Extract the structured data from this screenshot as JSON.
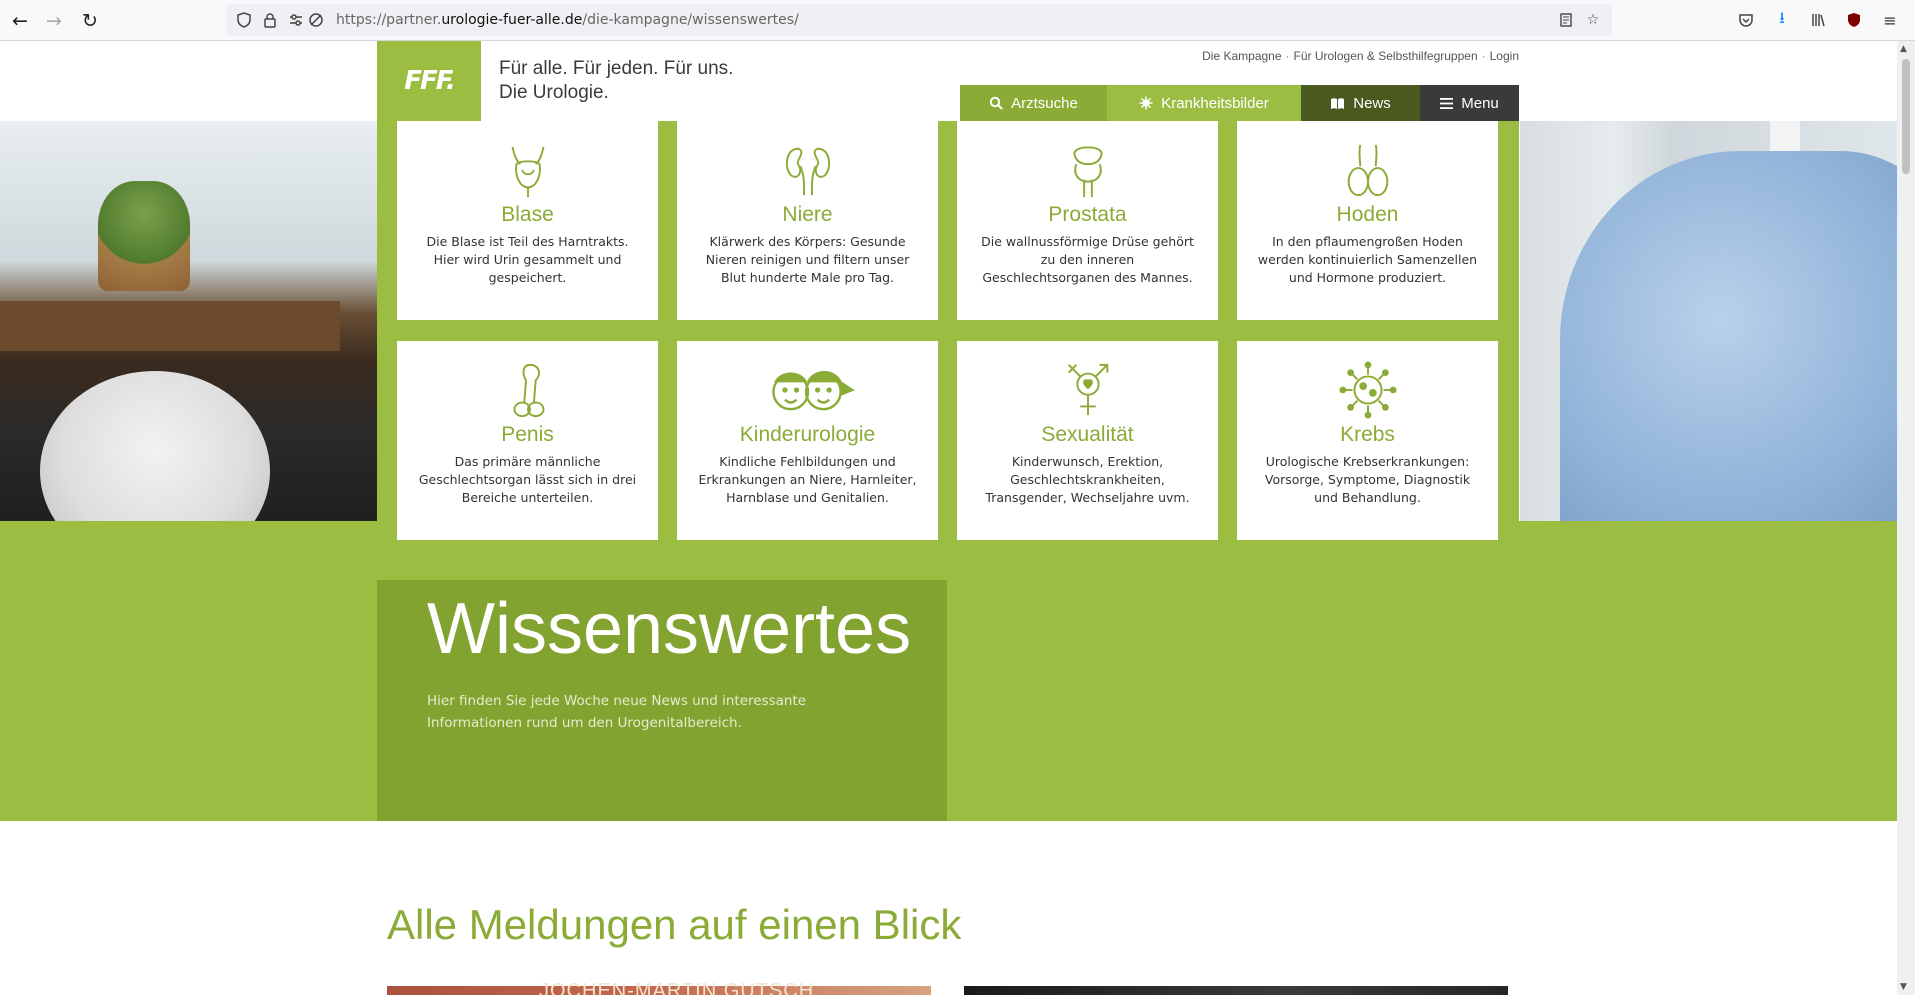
{
  "browser": {
    "url_prefix": "https://partner.",
    "url_domain": "urologie-fuer-alle.de",
    "url_path": "/die-kampagne/wissenswertes/"
  },
  "header": {
    "logo": "FFF.",
    "tagline_line1": "Für alle. Für jeden. Für uns.",
    "tagline_line2": "Die Urologie.",
    "toplinks": [
      "Die Kampagne",
      "Für Urologen & Selbsthilfegruppen",
      "Login"
    ],
    "toplink_separator": "·"
  },
  "nav": {
    "arztsuche": "Arztsuche",
    "krankheitsbilder": "Krankheitsbilder",
    "news": "News",
    "menu": "Menu"
  },
  "cards": [
    {
      "title": "Blase",
      "desc": "Die Blase ist Teil des Harntrakts. Hier wird Urin gesammelt und gespeichert."
    },
    {
      "title": "Niere",
      "desc": "Klärwerk des Körpers: Gesunde Nieren reinigen und filtern unser Blut hunderte Male pro Tag."
    },
    {
      "title": "Prostata",
      "desc": "Die wallnussförmige Drüse gehört zu den inneren Geschlechtsorganen des Mannes."
    },
    {
      "title": "Hoden",
      "desc": "In den pflaumengroßen Hoden werden kontinuierlich Samenzellen und Hormone produziert."
    },
    {
      "title": "Penis",
      "desc": "Das primäre männliche Geschlechtsorgan lässt sich in drei Bereiche unterteilen."
    },
    {
      "title": "Kinderurologie",
      "desc": "Kindliche Fehlbildungen und Erkrankungen an Niere, Harnleiter, Harnblase und Genitalien."
    },
    {
      "title": "Sexualität",
      "desc": "Kinderwunsch, Erektion, Geschlechtskrankheiten, Transgender, Wechseljahre uvm."
    },
    {
      "title": "Krebs",
      "desc": "Urologische Krebserkrankungen: Vorsorge, Symptome, Diagnostik und Behandlung."
    }
  ],
  "intro": {
    "title": "Wissenswertes",
    "text": "Hier finden Sie jede Woche neue News und interessante Informationen rund um den Urogenitalbereich."
  },
  "news_section": {
    "title": "Alle Meldungen auf einen Blick",
    "thumb1_text": "JOCHEN-MARTIN GUTSCH"
  },
  "colors": {
    "brand_green": "#9bbd42",
    "dark_green": "#83a330",
    "news_dark": "#4a5a1f"
  }
}
